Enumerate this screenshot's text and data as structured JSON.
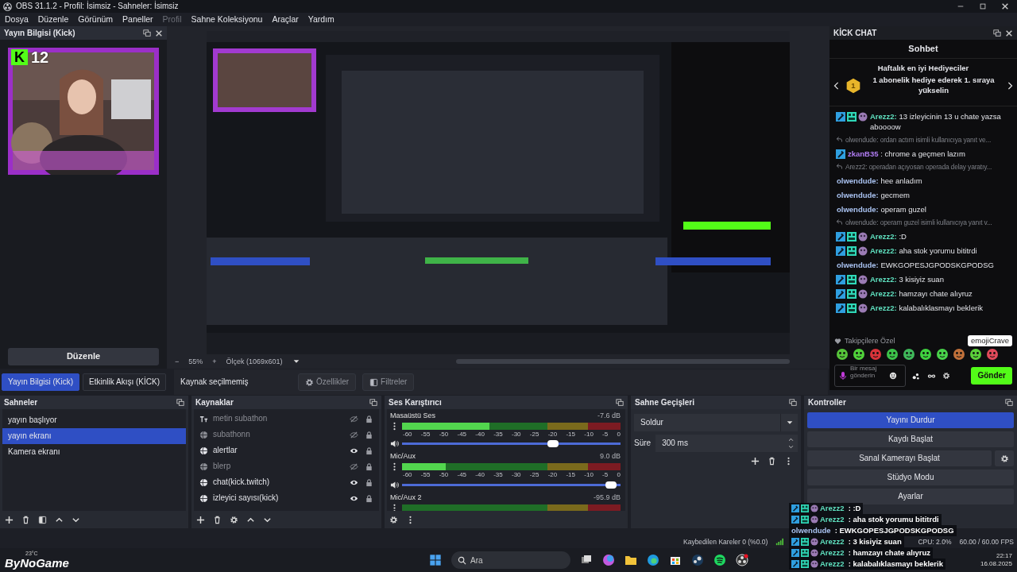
{
  "window": {
    "title": "OBS 31.1.2 - Profil: İsimsiz - Sahneler: İsimsiz"
  },
  "menu": [
    {
      "label": "Dosya",
      "disabled": false
    },
    {
      "label": "Düzenle",
      "disabled": false
    },
    {
      "label": "Görünüm",
      "disabled": false
    },
    {
      "label": "Paneller",
      "disabled": false
    },
    {
      "label": "Profil",
      "disabled": true
    },
    {
      "label": "Sahne Koleksiyonu",
      "disabled": false
    },
    {
      "label": "Araçlar",
      "disabled": false
    },
    {
      "label": "Yardım",
      "disabled": false
    }
  ],
  "stream_info_dock": {
    "title": "Yayın Bilgisi (Kick)",
    "button": "Düzenle"
  },
  "preview": {
    "zoom_out": "−",
    "zoom": "55%",
    "zoom_in": "+",
    "scale": "Ölçek (1069x601)"
  },
  "kick_chat": {
    "title": "KİCK CHAT",
    "heading": "Sohbet",
    "gifters_title": "Haftalık en iyi Hediyeciler",
    "rank": "1",
    "gifters_text": "1 abonelik hediye ederek 1. sıraya yükselin",
    "messages": [
      {
        "kind": "member",
        "user": "Arezz2:",
        "color": "#5fe0bf",
        "text": "13 izleyicinin 13 u chate yazsa aboooow"
      },
      {
        "kind": "reply",
        "text": "olwendude: ordan actım isimli kullanıcıya yanıt ve..."
      },
      {
        "kind": "moderator",
        "user": "zkanB35",
        "color": "#b07cf2",
        "text": ": chrome a geçmen lazım"
      },
      {
        "kind": "reply",
        "text": "Arezz2: operadan açıyosan operada delay yaratıy..."
      },
      {
        "kind": "message",
        "user": "olwendude:",
        "color": "#a9c2f0",
        "text": "hee anladım"
      },
      {
        "kind": "message",
        "user": "olwendude:",
        "color": "#a9c2f0",
        "text": "gecmem"
      },
      {
        "kind": "message",
        "user": "olwendude:",
        "color": "#a9c2f0",
        "text": "operam guzel"
      },
      {
        "kind": "reply",
        "text": "olwendude: operam guzel isimli kullanıcıya yanıt v..."
      },
      {
        "kind": "member",
        "user": "Arezz2:",
        "color": "#5fe0bf",
        "text": ":D"
      },
      {
        "kind": "member",
        "user": "Arezz2:",
        "color": "#5fe0bf",
        "text": "aha stok yorumu bititrdi"
      },
      {
        "kind": "message",
        "user": "olwendude:",
        "color": "#a9c2f0",
        "text": "EWKGOPESJGPODSKGPODSG"
      },
      {
        "kind": "member",
        "user": "Arezz2:",
        "color": "#5fe0bf",
        "text": "3 kisiyiz suan"
      },
      {
        "kind": "member",
        "user": "Arezz2:",
        "color": "#5fe0bf",
        "text": "hamzayı chate alıyruz"
      },
      {
        "kind": "member",
        "user": "Arezz2:",
        "color": "#5fe0bf",
        "text": "kalabalıklasmayı beklerik"
      }
    ],
    "section": "Takipçilere Özel",
    "tooltip": "emojiCrave",
    "input": {
      "placeholder": "Bir mesaj gönderin"
    },
    "send": "Gönder"
  },
  "dock_tabs": [
    {
      "label": "Yayın Bilgisi (Kick)",
      "selected": true
    },
    {
      "label": "Etkinlik Akışı (KİCK)",
      "selected": false
    }
  ],
  "source_toolbar": {
    "status": "Kaynak seçilmemiş",
    "buttons": [
      "Özellikler",
      "Filtreler"
    ]
  },
  "scenes": {
    "title": "Sahneler",
    "items": [
      {
        "label": "yayın başlıyor",
        "selected": false
      },
      {
        "label": "yayın ekranı",
        "selected": true
      },
      {
        "label": "Kamera ekranı",
        "selected": false
      }
    ]
  },
  "sources": {
    "title": "Kaynaklar",
    "items": [
      {
        "label": "metin subathon",
        "kind": "text",
        "visible": false
      },
      {
        "label": "subathonn",
        "kind": "browser",
        "visible": false
      },
      {
        "label": "alertlar",
        "kind": "browser",
        "visible": true
      },
      {
        "label": "blerp",
        "kind": "browser",
        "visible": false
      },
      {
        "label": "chat(kick.twitch)",
        "kind": "browser",
        "visible": true
      },
      {
        "label": "izleyici sayısı(kick)",
        "kind": "browser",
        "visible": true
      }
    ]
  },
  "audio_mixer": {
    "title": "Ses Karıştırıcı",
    "channels": [
      {
        "name": "Masaüstü Ses",
        "reading": "-7.6 dB",
        "meter": {
          "level": 0.4
        },
        "scale": [
          "-60",
          "-55",
          "-50",
          "-45",
          "-40",
          "-35",
          "-30",
          "-25",
          "-20",
          "-15",
          "-10",
          "-5",
          "0"
        ],
        "volume": {
          "level": 0.7
        }
      },
      {
        "name": "Mic/Aux",
        "reading": "9.0 dB",
        "meter": {
          "level": 0.2
        },
        "scale": [
          "-60",
          "-55",
          "-50",
          "-45",
          "-40",
          "-35",
          "-30",
          "-25",
          "-20",
          "-15",
          "-10",
          "-5",
          "0"
        ],
        "volume": {
          "level": 0.98
        }
      },
      {
        "name": "Mic/Aux 2",
        "reading": "-95.9 dB",
        "meter": {
          "level": 0
        }
      }
    ]
  },
  "transitions": {
    "title": "Sahne Geçişleri",
    "selected": "Soldur",
    "duration_label": "Süre",
    "duration": "300 ms"
  },
  "controls": {
    "title": "Kontroller",
    "buttons": [
      {
        "label": "Yayını Durdur",
        "active": true,
        "settings": false
      },
      {
        "label": "Kaydı Başlat",
        "active": false,
        "settings": false
      },
      {
        "label": "Sanal Kamerayı Başlat",
        "active": false,
        "settings": true
      },
      {
        "label": "Stüdyo Modu",
        "active": false,
        "settings": false
      },
      {
        "label": "Ayarlar",
        "active": false,
        "settings": false
      }
    ]
  },
  "status_bar": {
    "dropped": "Kaybedilen Kareler 0 (%0.0)",
    "cpu": "CPU: 2.0%",
    "fps": "60.00 / 60.00 FPS"
  },
  "overlays": {
    "viewer_badge": "K",
    "viewer_count": "12",
    "logo": "ByNoGame",
    "chat": [
      {
        "kind": "member",
        "user": "Arezz2",
        "color": "#5fe0bf",
        "text": ": :D"
      },
      {
        "kind": "member",
        "user": "Arezz2",
        "color": "#5fe0bf",
        "text": ": aha stok yorumu bititrdi"
      },
      {
        "kind": "message",
        "user": "olwendude",
        "color": "#a9c2f0",
        "text": ": EWKGOPESJGPODSKGPODSG"
      },
      {
        "kind": "member",
        "user": "Arezz2",
        "color": "#5fe0bf",
        "text": ": 3 kisiyiz suan"
      },
      {
        "kind": "member",
        "user": "Arezz2",
        "color": "#5fe0bf",
        "text": ": hamzayı chate alıyruz"
      },
      {
        "kind": "member",
        "user": "Arezz2",
        "color": "#5fe0bf",
        "text": ": kalabalıklasmayı beklerik"
      }
    ]
  },
  "taskbar": {
    "weather": "23°C",
    "search": {
      "placeholder": "Ara"
    },
    "time": "22:17",
    "date": "16.08.2025"
  }
}
